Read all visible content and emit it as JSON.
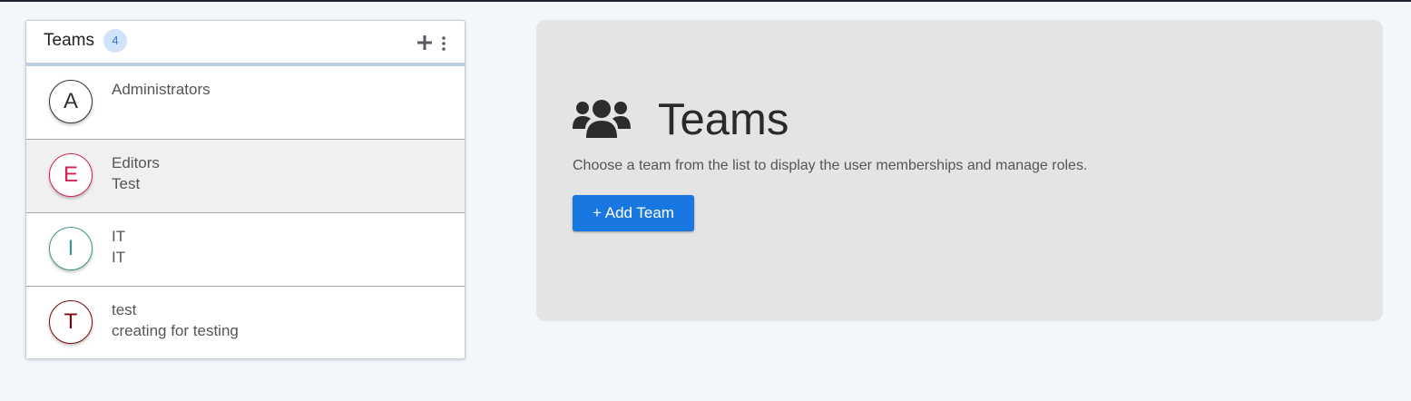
{
  "colors": {
    "accent": "#1877e0",
    "page_background": "#f3f6fb",
    "info_background": "#e4e4e4",
    "badge_background": "#cfe3fb",
    "header_underline": "#bcd1e3"
  },
  "teams_panel": {
    "title": "Teams",
    "count": "4",
    "add_icon": "plus-icon",
    "menu_icon": "more-vertical-icon",
    "teams": [
      {
        "initial": "A",
        "name": "Administrators",
        "description": "",
        "color": "#333333",
        "selected": false
      },
      {
        "initial": "E",
        "name": "Editors",
        "description": "Test",
        "color": "#d9224f",
        "selected": true
      },
      {
        "initial": "I",
        "name": "IT",
        "description": "IT",
        "color": "#3a9a8a",
        "selected": false
      },
      {
        "initial": "T",
        "name": "test",
        "description": "creating for testing",
        "color": "#7a0a0a",
        "selected": false
      }
    ]
  },
  "info_panel": {
    "icon": "users-icon",
    "title": "Teams",
    "text": "Choose a team from the list to display the user memberships and manage roles.",
    "add_button": "+ Add Team"
  }
}
